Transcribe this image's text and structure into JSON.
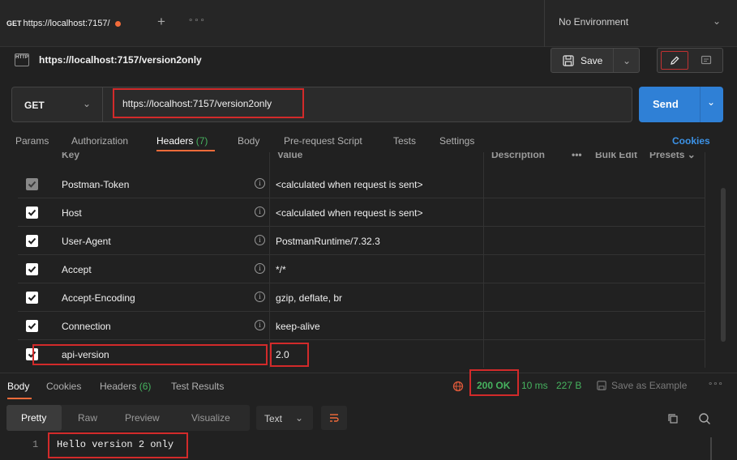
{
  "tab": {
    "method": "GET",
    "url_label": "https://localhost:7157/",
    "plus": "+",
    "more": "∘∘∘"
  },
  "environment": {
    "label": "No Environment"
  },
  "request": {
    "title": "https://localhost:7157/version2only",
    "save_label": "Save",
    "method": "GET",
    "url": "https://localhost:7157/version2only",
    "send_label": "Send"
  },
  "request_tabs": [
    {
      "label": "Params"
    },
    {
      "label": "Authorization"
    },
    {
      "label": "Headers",
      "count": "(7)"
    },
    {
      "label": "Body"
    },
    {
      "label": "Pre-request Script"
    },
    {
      "label": "Tests"
    },
    {
      "label": "Settings"
    }
  ],
  "cookies_label": "Cookies",
  "headers_columns": {
    "key": "Key",
    "value": "Value",
    "description": "Description",
    "more": "•••",
    "bulk_edit": "Bulk Edit",
    "presets": "Presets ⌄"
  },
  "headers": [
    {
      "key": "Postman-Token",
      "value": "<calculated when request is sent>",
      "checked": true,
      "dim": true
    },
    {
      "key": "Host",
      "value": "<calculated when request is sent>",
      "checked": true
    },
    {
      "key": "User-Agent",
      "value": "PostmanRuntime/7.32.3",
      "checked": true
    },
    {
      "key": "Accept",
      "value": "*/*",
      "checked": true
    },
    {
      "key": "Accept-Encoding",
      "value": "gzip, deflate, br",
      "checked": true
    },
    {
      "key": "Connection",
      "value": "keep-alive",
      "checked": true
    },
    {
      "key": "api-version",
      "value": "2.0",
      "checked": true
    }
  ],
  "info_glyph": "i",
  "response_tabs": [
    {
      "label": "Body"
    },
    {
      "label": "Cookies"
    },
    {
      "label": "Headers",
      "count": "(6)"
    },
    {
      "label": "Test Results"
    }
  ],
  "response": {
    "status": "200 OK",
    "time": "10 ms",
    "size": "227 B",
    "save_example": "Save as Example",
    "more": "∘∘∘",
    "formats": [
      "Pretty",
      "Raw",
      "Preview",
      "Visualize"
    ],
    "text_select": "Text",
    "line_number": "1",
    "body_line": "Hello version 2 only"
  },
  "colors": {
    "accent": "#f26b3a",
    "send": "#2f80d6",
    "success": "#46b35f",
    "highlight": "#d22a2a"
  }
}
